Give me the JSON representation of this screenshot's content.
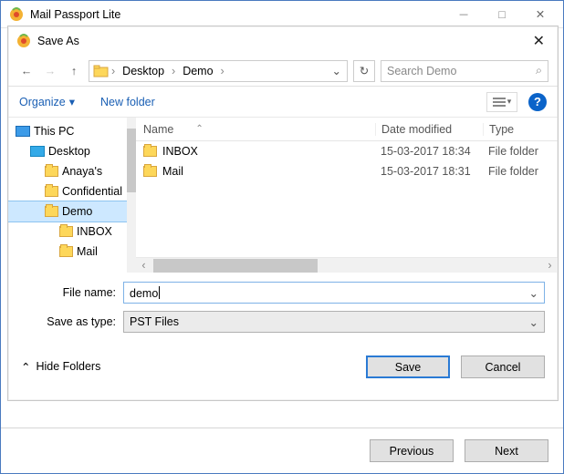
{
  "outer": {
    "title": "Mail Passport Lite",
    "buttons": {
      "prev": "Previous",
      "next": "Next"
    }
  },
  "dialog": {
    "title": "Save As",
    "close_icon": "close",
    "nav": {
      "back_enabled": true,
      "forward_enabled": false,
      "up_enabled": true,
      "crumbs": [
        "Desktop",
        "Demo"
      ],
      "search_placeholder": "Search Demo"
    },
    "toolbar": {
      "organize": "Organize",
      "new_folder": "New folder",
      "help_icon": "?"
    },
    "tree": [
      {
        "label": "This PC",
        "icon": "pc",
        "indent": 0
      },
      {
        "label": "Desktop",
        "icon": "desktop",
        "indent": 1
      },
      {
        "label": "Anaya's",
        "icon": "folder",
        "indent": 2
      },
      {
        "label": "Confidential",
        "icon": "folder",
        "indent": 2
      },
      {
        "label": "Demo",
        "icon": "folder",
        "indent": 2,
        "selected": true
      },
      {
        "label": "INBOX",
        "icon": "folder",
        "indent": 3
      },
      {
        "label": "Mail",
        "icon": "folder",
        "indent": 3
      }
    ],
    "columns": {
      "name": "Name",
      "date": "Date modified",
      "type": "Type"
    },
    "rows": [
      {
        "name": "INBOX",
        "date": "15-03-2017 18:34",
        "type": "File folder"
      },
      {
        "name": "Mail",
        "date": "15-03-2017 18:31",
        "type": "File folder"
      }
    ],
    "form": {
      "file_label": "File name:",
      "file_value": "demo",
      "type_label": "Save as type:",
      "type_value": "PST Files"
    },
    "bottom": {
      "hide_folders": "Hide Folders",
      "save": "Save",
      "cancel": "Cancel"
    }
  }
}
